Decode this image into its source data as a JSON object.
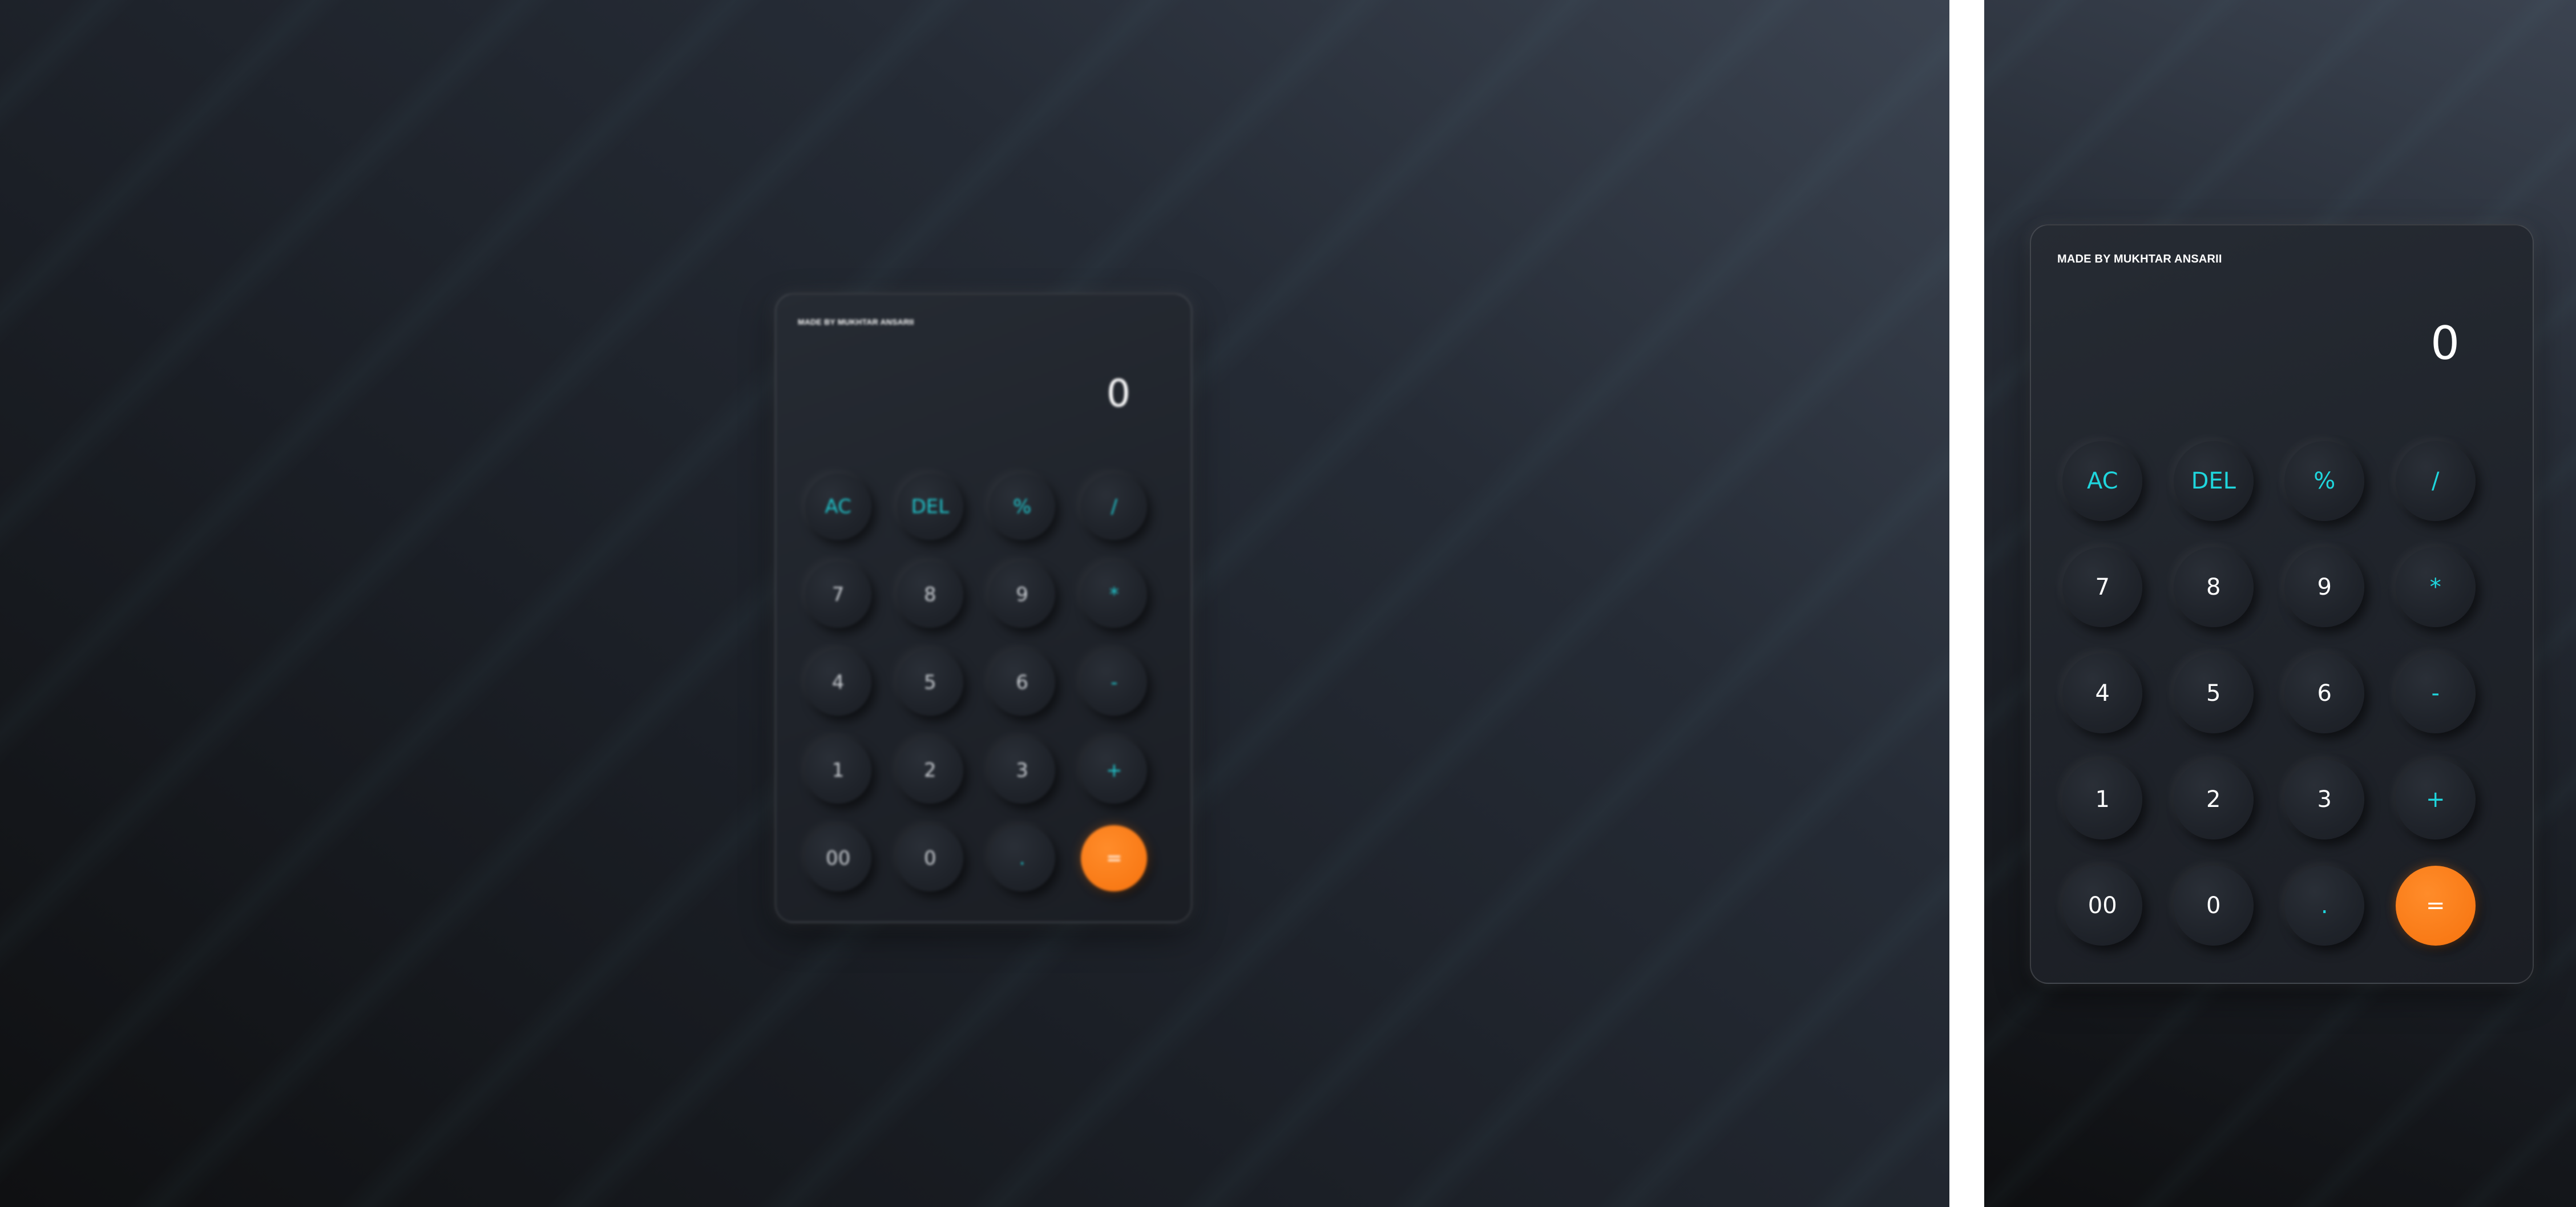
{
  "credit": "MADE BY MUKHTAR ANSARII",
  "display": "0",
  "keys": [
    {
      "label": "AC",
      "kind": "op"
    },
    {
      "label": "DEL",
      "kind": "op"
    },
    {
      "label": "%",
      "kind": "op"
    },
    {
      "label": "/",
      "kind": "op"
    },
    {
      "label": "7",
      "kind": "num"
    },
    {
      "label": "8",
      "kind": "num"
    },
    {
      "label": "9",
      "kind": "num"
    },
    {
      "label": "*",
      "kind": "op"
    },
    {
      "label": "4",
      "kind": "num"
    },
    {
      "label": "5",
      "kind": "num"
    },
    {
      "label": "6",
      "kind": "num"
    },
    {
      "label": "-",
      "kind": "op"
    },
    {
      "label": "1",
      "kind": "num"
    },
    {
      "label": "2",
      "kind": "num"
    },
    {
      "label": "3",
      "kind": "num"
    },
    {
      "label": "+",
      "kind": "op"
    },
    {
      "label": "00",
      "kind": "num"
    },
    {
      "label": "0",
      "kind": "num"
    },
    {
      "label": ".",
      "kind": "op"
    },
    {
      "label": "=",
      "kind": "equals"
    }
  ],
  "colors": {
    "accent": "#1fd6dd",
    "equals": "#f97a16",
    "text": "#ffffff",
    "card": "#1f232a"
  }
}
